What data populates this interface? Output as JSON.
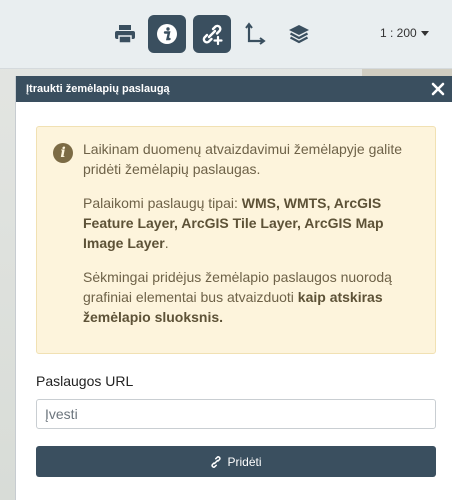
{
  "toolbar": {
    "buttons": [
      {
        "icon": "print-icon"
      },
      {
        "icon": "info-icon"
      },
      {
        "icon": "add-link-icon"
      },
      {
        "icon": "measure-axes-icon"
      },
      {
        "icon": "layers-icon"
      }
    ],
    "scale": "1 : 200"
  },
  "dialog": {
    "title": "Įtraukti žemėlapių paslaugą",
    "alert": {
      "p1": "Laikinam duomenų atvaizdavimui žemėlapyje galite pridėti žemėlapių paslaugas.",
      "p2_prefix": "Palaikomi paslaugų tipai: ",
      "p2_bold": "WMS, WMTS, ArcGIS Feature Layer, ArcGIS Tile Layer, ArcGIS Map Image Layer",
      "p2_suffix": ".",
      "p3_prefix": "Sėkmingai pridėjus žemėlapio paslaugos nuorodą grafiniai elementai bus atvaizduoti ",
      "p3_bold": "kaip atskiras žemėlapio sluoksnis."
    },
    "url_label": "Paslaugos URL",
    "url_placeholder": "Įvesti",
    "url_value": "",
    "add_label": "Pridėti"
  },
  "colors": {
    "primary": "#3a4f5f",
    "alert_bg": "#fdf4dc",
    "alert_text": "#6e6248"
  }
}
